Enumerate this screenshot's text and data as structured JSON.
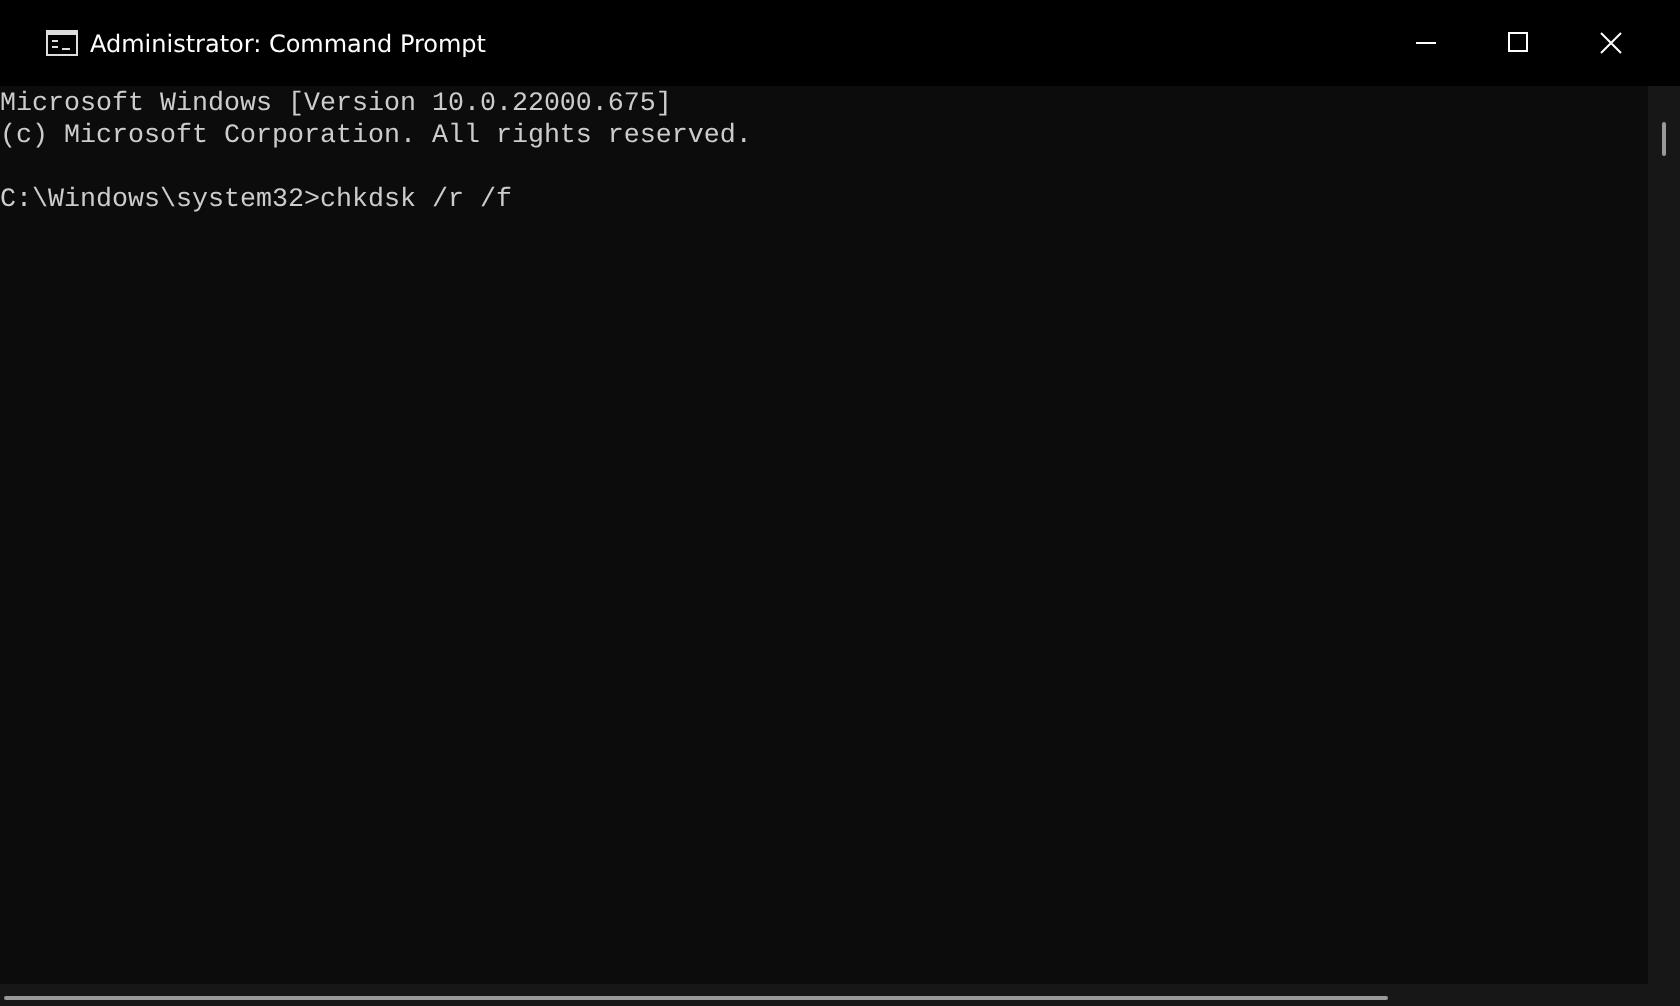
{
  "window": {
    "title": "Administrator: Command Prompt"
  },
  "console": {
    "output": [
      "Microsoft Windows [Version 10.0.22000.675]",
      "(c) Microsoft Corporation. All rights reserved."
    ],
    "prompt": {
      "path": "C:\\Windows\\system32>",
      "command": "chkdsk /r /f"
    }
  }
}
